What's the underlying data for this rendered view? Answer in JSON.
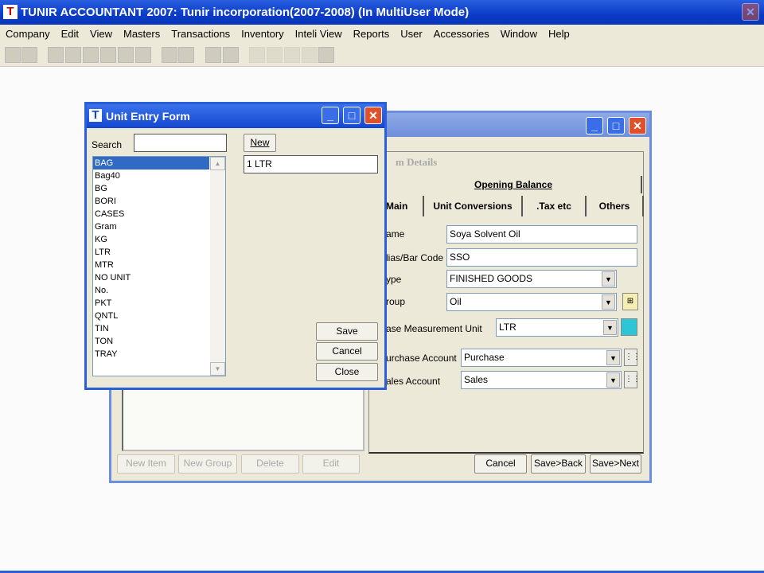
{
  "app": {
    "title": "TUNIR ACCOUNTANT 2007:  Tunir incorporation(2007-2008) (In MultiUser Mode)",
    "logo": "T"
  },
  "menu": [
    "Company",
    "Edit",
    "View",
    "Masters",
    "Transactions",
    "Inventory",
    "Inteli View",
    "Reports",
    "User",
    "Accessories",
    "Window",
    "Help"
  ],
  "item_window": {
    "section_title": "m Details",
    "opening_balance_tab": "Opening Balance",
    "tabs": [
      "Main",
      "Unit Conversions",
      ".Tax etc",
      "Others"
    ],
    "fields": {
      "name_label": "ame",
      "name_value": "Soya Solvent Oil",
      "alias_label": "lias/Bar Code",
      "alias_value": "SSO",
      "type_label": "ype",
      "type_value": "FINISHED GOODS",
      "group_label": "roup",
      "group_value": "Oil",
      "unit_label": "ase Measurement Unit",
      "unit_value": "LTR",
      "purchase_label": "urchase Account",
      "purchase_value": "Purchase",
      "sales_label": "ales Account",
      "sales_value": "Sales"
    },
    "left_buttons": [
      "New Item",
      "New Group",
      "Delete",
      "Edit"
    ],
    "right_buttons": [
      "Cancel",
      "Save>Back",
      "Save>Next"
    ]
  },
  "unit_form": {
    "title": "Unit Entry Form",
    "search_label": "Search",
    "search_value": "",
    "units": [
      "BAG",
      "Bag40",
      "BG",
      "BORI",
      "CASES",
      "Gram",
      "KG",
      "LTR",
      "MTR",
      "NO UNIT",
      "No.",
      "PKT",
      "QNTL",
      "TIN",
      "TON",
      "TRAY"
    ],
    "selected": "BAG",
    "new_label": "New",
    "unit_input": "1 LTR",
    "save": "Save",
    "cancel": "Cancel",
    "close": "Close"
  }
}
